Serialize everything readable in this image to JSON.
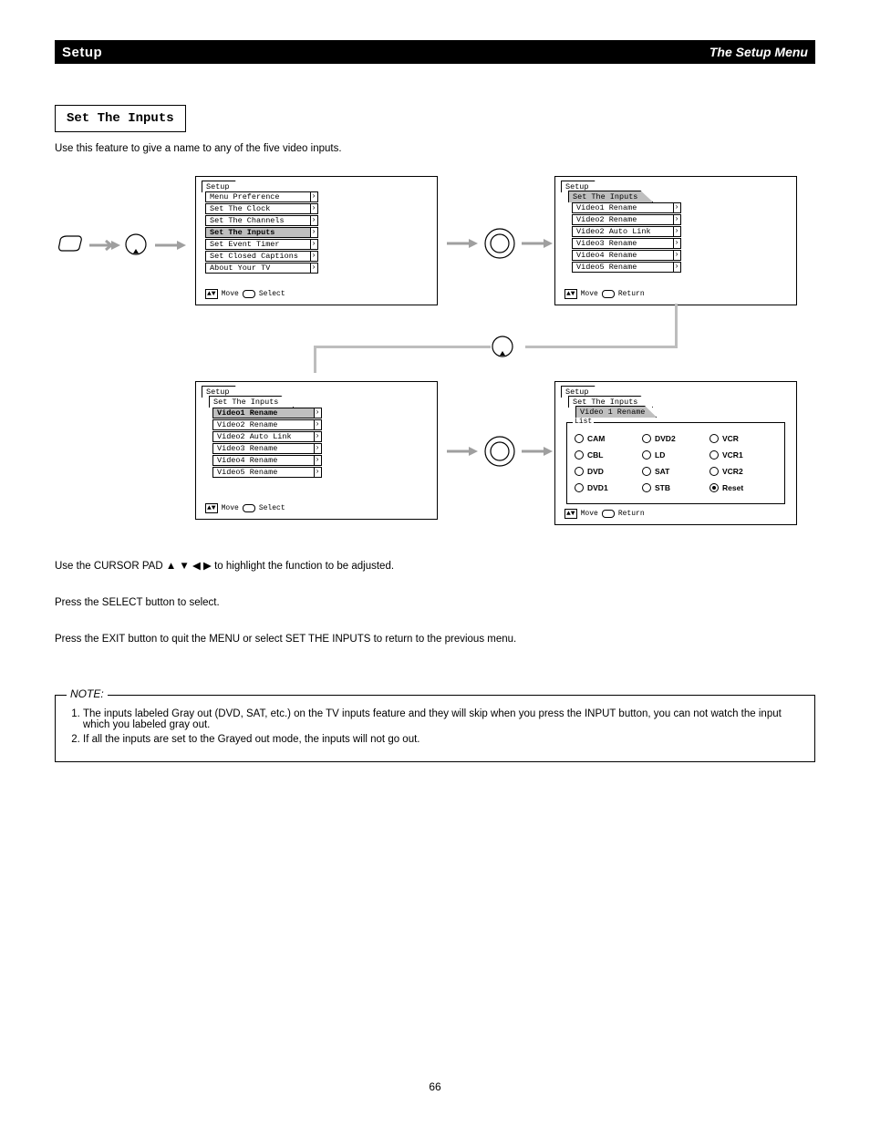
{
  "header": {
    "title": "Setup",
    "page_label": "The Setup Menu"
  },
  "section_title": "Set The Inputs",
  "intro": "Use this feature to give a name to any of the five video inputs.",
  "osd_screens": {
    "a": {
      "tab": "Setup",
      "items": [
        "Menu Preference",
        "Set The Clock",
        "Set The Channels",
        "Set The Inputs",
        "Set Event Timer",
        "Set Closed Captions",
        "About Your TV"
      ],
      "selected_index": 3,
      "hint_left": "Move",
      "hint_right": "Select"
    },
    "b": {
      "tab": "Setup",
      "subtitle": "Set The Inputs",
      "items": [
        "Video1 Rename",
        "Video2 Rename",
        "Video2 Auto Link",
        "Video3 Rename",
        "Video4 Rename",
        "Video5 Rename"
      ],
      "hint_left": "Move",
      "hint_right": "Return"
    },
    "c": {
      "tab": "Setup",
      "subtitle": "Set The Inputs",
      "items": [
        "Video1 Rename",
        "Video2 Rename",
        "Video2 Auto Link",
        "Video3 Rename",
        "Video4 Rename",
        "Video5 Rename"
      ],
      "selected_index": 0,
      "hint_left": "Move",
      "hint_right": "Select"
    },
    "d": {
      "tab": "Setup",
      "subtitle": "Set The Inputs",
      "sub2": "Video 1 Rename",
      "list_label": "List",
      "options": [
        "CAM",
        "DVD2",
        "VCR",
        "CBL",
        "LD",
        "VCR1",
        "DVD",
        "SAT",
        "VCR2",
        "DVD1",
        "STB",
        "Reset"
      ],
      "selected_option": "Reset",
      "hint_left": "Move",
      "hint_right": "Return"
    }
  },
  "instructions": {
    "line1_prefix": "Use the CURSOR PAD    ",
    "line1_rest": " to highlight the function to be adjusted.",
    "line2": "Press the SELECT button to select.",
    "line3": "Press the EXIT button to quit the MENU or select SET THE INPUTS to return to the previous menu."
  },
  "note": {
    "label": "NOTE:",
    "items": [
      "The inputs labeled Gray out (DVD, SAT, etc.) on the TV inputs feature and they will skip when you press the INPUT button, you can not watch the input which you labeled gray out.",
      "If all the inputs are set to the Grayed out mode, the inputs will not go out."
    ]
  },
  "page_number": "66"
}
